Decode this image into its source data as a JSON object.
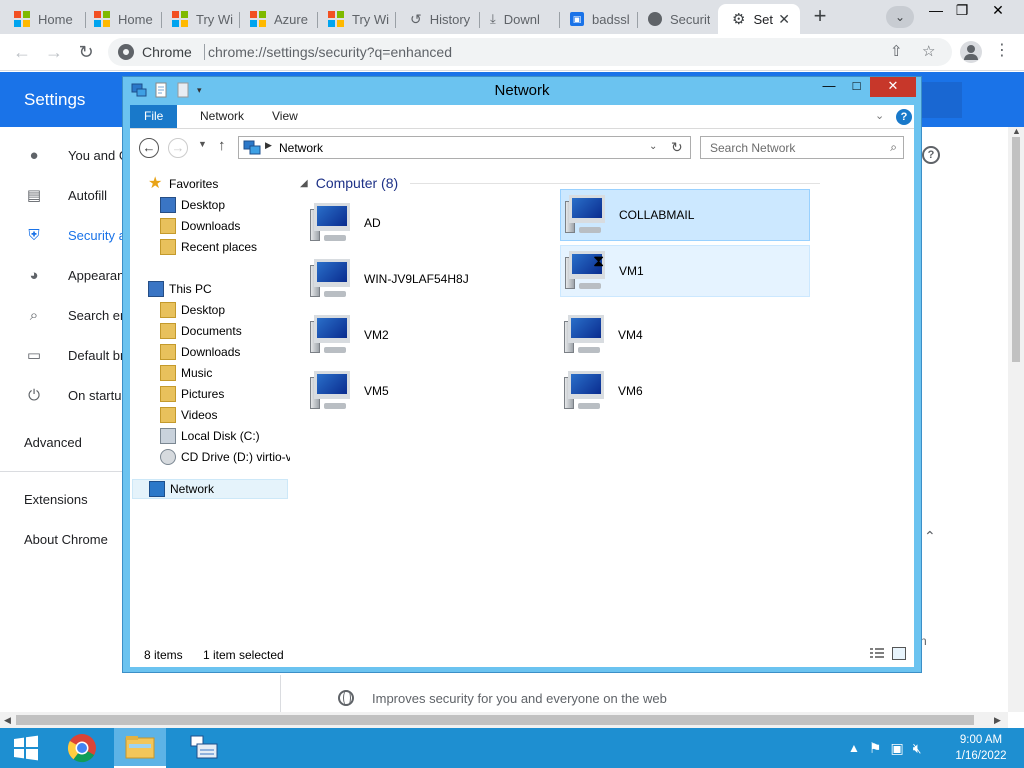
{
  "browser": {
    "tabs": [
      {
        "label": "Home",
        "icon": "microsoft-logo-icon"
      },
      {
        "label": "Home",
        "icon": "microsoft-logo-icon"
      },
      {
        "label": "Try Wi",
        "icon": "microsoft-logo-icon"
      },
      {
        "label": "Azure",
        "icon": "microsoft-logo-icon"
      },
      {
        "label": "Try Wi",
        "icon": "microsoft-logo-icon"
      },
      {
        "label": "History",
        "icon": "history-icon"
      },
      {
        "label": "Downl",
        "icon": "download-icon"
      },
      {
        "label": "badssl",
        "icon": "lock-icon"
      },
      {
        "label": "Securit",
        "icon": "chrome-globe-icon"
      },
      {
        "label": "Set",
        "icon": "gear-icon",
        "active": true
      }
    ],
    "omnibox": {
      "site_label": "Chrome",
      "url": "chrome://settings/security?q=enhanced"
    }
  },
  "settings": {
    "title": "Settings",
    "sidebar": [
      {
        "label": "You and G",
        "icon": "person-icon"
      },
      {
        "label": "Autofill",
        "icon": "clipboard-icon"
      },
      {
        "label": "Security a",
        "icon": "shield-icon",
        "active": true
      },
      {
        "label": "Appearan",
        "icon": "palette-icon"
      },
      {
        "label": "Search en",
        "icon": "search-icon"
      },
      {
        "label": "Default br",
        "icon": "browser-window-icon"
      },
      {
        "label": "On startu",
        "icon": "power-icon"
      }
    ],
    "advanced": "Advanced",
    "extensions": "Extensions",
    "about": "About Chrome",
    "right_fragment": "n",
    "enhanced_description": "Improves security for you and everyone on the web"
  },
  "explorer": {
    "title": "Network",
    "ribbon_tabs": [
      "File",
      "Network",
      "View"
    ],
    "address": "Network",
    "search_placeholder": "Search Network",
    "nav_tree": {
      "favorites": "Favorites",
      "favorites_items": [
        "Desktop",
        "Downloads",
        "Recent places"
      ],
      "this_pc": "This PC",
      "this_pc_items": [
        "Desktop",
        "Documents",
        "Downloads",
        "Music",
        "Pictures",
        "Videos",
        "Local Disk (C:)",
        "CD Drive (D:) virtio-v"
      ],
      "network": "Network"
    },
    "group_header": "Computer (8)",
    "computers": [
      {
        "name": "AD"
      },
      {
        "name": "COLLABMAIL",
        "state": "selected"
      },
      {
        "name": "WIN-JV9LAF54H8J"
      },
      {
        "name": "VM1",
        "state": "hover"
      },
      {
        "name": "VM2"
      },
      {
        "name": "VM4"
      },
      {
        "name": "VM5"
      },
      {
        "name": "VM6"
      }
    ],
    "status": {
      "count": "8 items",
      "selection": "1 item selected"
    }
  },
  "taskbar": {
    "apps": [
      "windows-start-icon",
      "chrome-icon",
      "file-explorer-icon",
      "network-folder-icon"
    ],
    "clock": {
      "time": "9:00 AM",
      "date": "1/16/2022"
    }
  },
  "colors": {
    "chrome_blue": "#1a73e8",
    "explorer_frame": "#6bc3f0",
    "taskbar": "#1e8fd1",
    "selection": "#cce8ff"
  }
}
